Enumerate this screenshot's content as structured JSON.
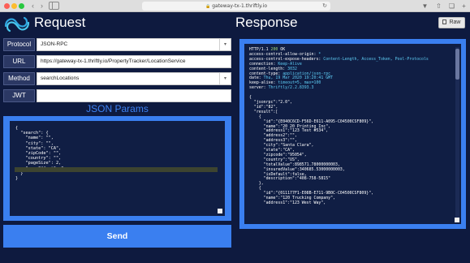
{
  "browser": {
    "url": "gateway-tx-1.thriftly.io"
  },
  "app": {
    "request_title": "Request",
    "response_title": "Response",
    "raw_label": "Raw"
  },
  "form": {
    "protocol": {
      "label": "Protocol",
      "value": "JSON-RPC"
    },
    "url": {
      "label": "URL",
      "value": "https://gateway-tx-1.thriftly.io/PropertyTracker/LocationService"
    },
    "method": {
      "label": "Method",
      "value": "searchLocations"
    },
    "jwt": {
      "label": "JWT",
      "value": ""
    }
  },
  "params": {
    "title": "JSON Params",
    "lines": [
      "{",
      "  \"search\": {",
      "    \"name\": \"\",",
      "    \"city\": \"\",",
      "    \"state\": \"CA\",",
      "    \"zipCode\": \"\",",
      "    \"country\": \"\",",
      "    \"pageSize\": 2,",
      "    \"pageOffset\": 0",
      "  }",
      "}"
    ]
  },
  "send_label": "Send",
  "response": {
    "status": "HTTP/1.1 200 OK",
    "headers": [
      {
        "key": "access-control-allow-origin:",
        "value": "*"
      },
      {
        "key": "access-control-expose-headers:",
        "value": "Content-Length, Access_Token, Pool-Protocols"
      },
      {
        "key": "connection:",
        "value": "Keep-Alive"
      },
      {
        "key": "content-length:",
        "value": "3032"
      },
      {
        "key": "content-type:",
        "value": "application/json-rpc"
      },
      {
        "key": "date:",
        "value": "Thu, 19 Mar 2020 19:20:41 GMT"
      },
      {
        "key": "keep-alive:",
        "value": "timeout=5, max=100"
      },
      {
        "key": "server:",
        "value": "Thriftly/2.2.8393.3"
      }
    ],
    "body_lines": [
      "{",
      "  \"jsonrpc\":\"2.0\",",
      "  \"id\":\"82\",",
      "  \"result\":[",
      "    {",
      "      \"id\":\"{E040C6CD-F56D-E611-A095-C04500CSF809}\",",
      "      \"name\":\"20 20 Printing Inc\",",
      "      \"address1\":\"123 Test #534\",",
      "      \"address2\":\"\",",
      "      \"address3\":\"\",",
      "      \"city\":\"Santa Clara\",",
      "      \"state\":\"CA\",",
      "      \"zipcode\":\"95054\",",
      "      \"country\":\"US\",",
      "      \"totalValue\":898571.78000000003,",
      "      \"insuredValue\":340685.53000000003,",
      "      \"isDefault\":false,",
      "      \"description\":\"408-758-5815\"",
      "    },",
      "    {",
      "      \"id\":\"{011177F1-E08B-E711-9B0C-C04500CSF809}\",",
      "      \"name\":\"120 Trucking Company\",",
      "      \"address1\":\"123 West Way\","
    ]
  },
  "colors": {
    "app_bg": "#0e1a3f",
    "accent": "#3a7ff0",
    "header_key": "#ffffff",
    "header_value": "#5ecdf5"
  },
  "icons": [
    "back-icon",
    "forward-icon",
    "sidebar-icon",
    "lock-icon",
    "reload-icon",
    "download-icon",
    "share-icon",
    "new-tab-icon",
    "thriftly-logo",
    "document-icon",
    "dropdown-caret-icon"
  ]
}
